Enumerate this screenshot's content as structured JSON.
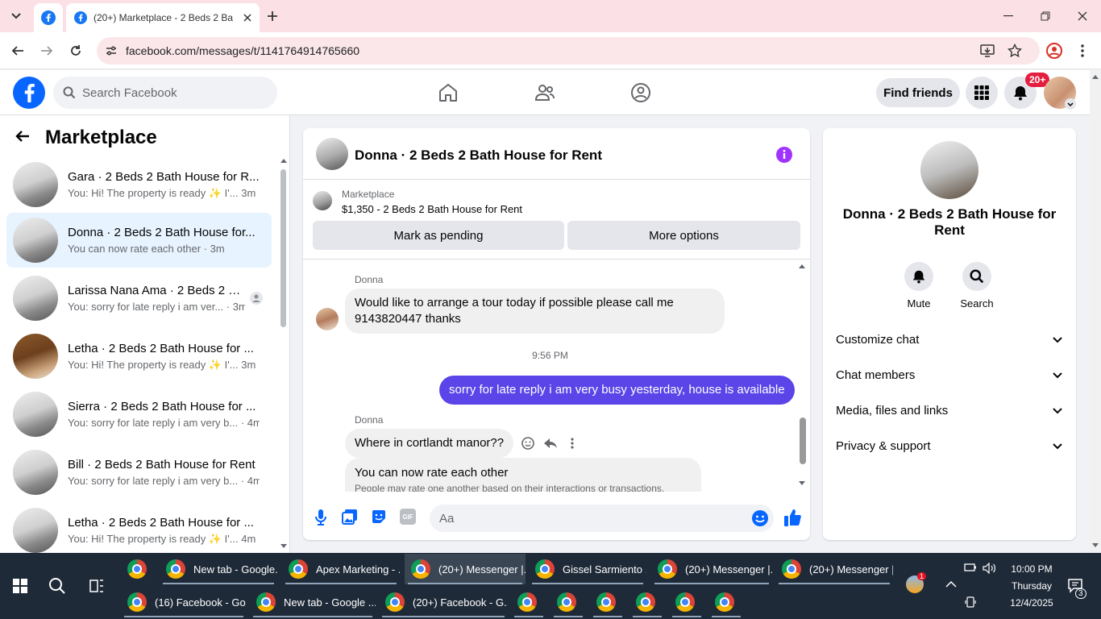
{
  "browser": {
    "tab_title": "(20+) Marketplace - 2 Beds 2 Ba",
    "url": "facebook.com/messages/t/1141764914765660"
  },
  "fb": {
    "search_placeholder": "Search Facebook",
    "find_friends": "Find friends",
    "notif_count": "20+"
  },
  "sidebar": {
    "title": "Marketplace",
    "conversations": [
      {
        "name": "Gara · 2 Beds 2 Bath House for R...",
        "preview": "You: Hi! The property is ready ✨ I'... ",
        "time": "3m"
      },
      {
        "name": "Donna · 2 Beds 2 Bath House for...",
        "preview": "You can now rate each other · ",
        "time": "3m"
      },
      {
        "name": "Larissa Nana Ama · 2 Beds 2 B...",
        "preview": "You: sorry for late reply i am ver... · ",
        "time": "3m"
      },
      {
        "name": "Letha · 2 Beds 2 Bath House for ...",
        "preview": "You: Hi! The property is ready ✨ I'... ",
        "time": "3m"
      },
      {
        "name": "Sierra · 2 Beds 2 Bath House for ...",
        "preview": "You: sorry for late reply i am very b... · ",
        "time": "4m"
      },
      {
        "name": "Bill · 2 Beds 2 Bath House for Rent",
        "preview": "You: sorry for late reply i am very b... · ",
        "time": "4m"
      },
      {
        "name": "Letha · 2 Beds 2 Bath House for ...",
        "preview": "You: Hi! The property is ready ✨ I'... ",
        "time": "4m"
      }
    ]
  },
  "chat": {
    "title": "Donna · 2 Beds 2 Bath House for Rent",
    "marketplace_label": "Marketplace",
    "listing": "$1,350 - 2 Beds 2 Bath House for Rent",
    "mark_pending": "Mark as pending",
    "more_options": "More options",
    "sender": "Donna",
    "msg1": "Would like to arrange a tour today if possible please call me 9143820447 thanks",
    "time1": "9:56 PM",
    "msg_me": "sorry for late reply i am very busy yesterday, house is available",
    "msg2": "Where in cortlandt manor??",
    "sys_title": "You can now rate each other",
    "sys_sub": "People may rate one another based on their interactions or transactions.",
    "composer_placeholder": "Aa",
    "gif_label": "GIF"
  },
  "info": {
    "name": "Donna · 2 Beds 2 Bath House for Rent",
    "mute": "Mute",
    "search": "Search",
    "sections": [
      "Customize chat",
      "Chat members",
      "Media, files and links",
      "Privacy & support"
    ]
  },
  "taskbar": {
    "row1": [
      "",
      "New tab - Google...",
      "Apex Marketing - ...",
      "(20+) Messenger |...",
      "Gissel Sarmiento ...",
      "(20+) Messenger |...",
      "(20+) Messenger |..."
    ],
    "row2": [
      "(16) Facebook - Go...",
      "New tab - Google ...",
      "(20+) Facebook - G..."
    ],
    "time": "10:00 PM",
    "day": "Thursday",
    "date": "12/4/2025",
    "chat_badge": "3",
    "tray_badge": "1"
  }
}
